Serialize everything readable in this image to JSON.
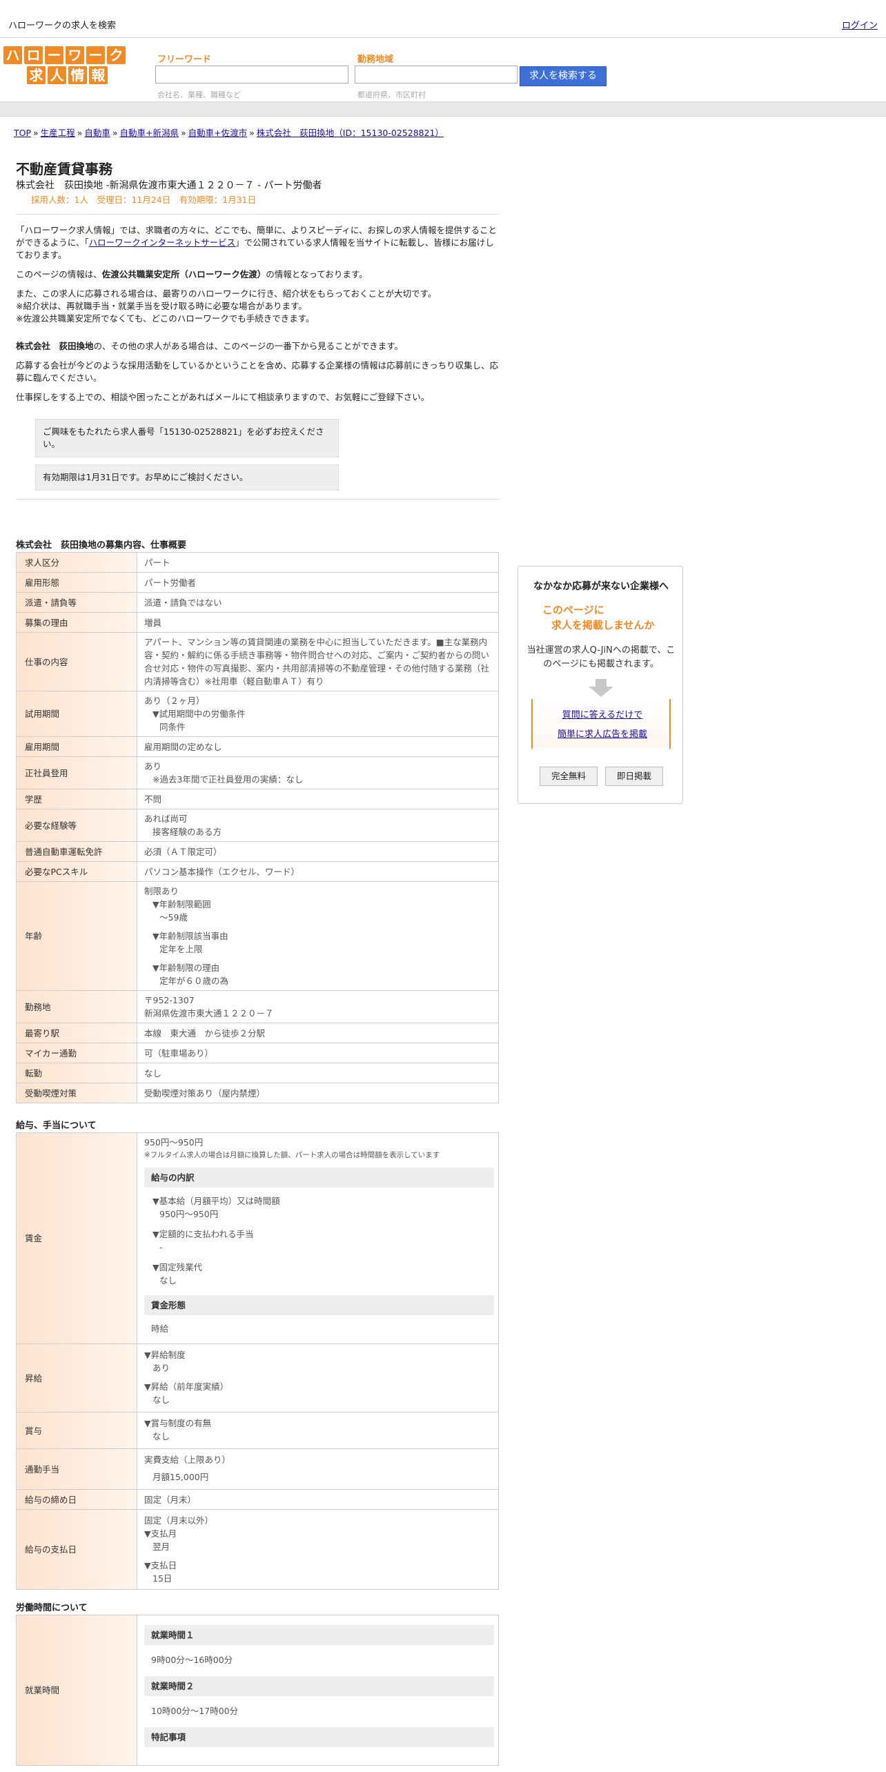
{
  "topbar": {
    "site_title": "ハローワークの求人を検索",
    "login": "ログイン"
  },
  "logo": {
    "row1": [
      "ハ",
      "ロ",
      "ー",
      "ワ",
      "ー",
      "ク"
    ],
    "row2": [
      "求",
      "人",
      "情",
      "報"
    ]
  },
  "search": {
    "freeword_label": "フリーワード",
    "freeword_hint": "会社名、業種、職種など",
    "area_label": "勤務地域",
    "area_hint": "都道府県、市区町村",
    "button": "求人を検索する"
  },
  "breadcrumb": [
    "TOP",
    "生産工程",
    "自動車",
    "自動車+新潟県",
    "自動車+佐渡市",
    "株式会社　荻田換地（ID：15130-02528821）"
  ],
  "job": {
    "title": "不動産賃貸事務",
    "subtitle": "株式会社　荻田換地 -新潟県佐渡市東大通１２２０－７ - パート労働者",
    "meta": "採用人数：1人　受理日：11月24日　有効期限：1月31日"
  },
  "intro": {
    "p1_a": "「ハローワーク求人情報」では、求職者の方々に、どこでも、簡単に、よりスピーディに、お探しの求人情報を提供することができるように、「",
    "p1_link": "ハローワークインターネットサービス",
    "p1_b": "」で公開されている求人情報を当サイトに転載し、皆様にお届けしております。",
    "p2_a": "このページの情報は、",
    "p2_bold": "佐渡公共職業安定所（ハローワーク佐渡）",
    "p2_b": "の情報となっております。",
    "p3_l1": "また、この求人に応募される場合は、最寄りのハローワークに行き、紹介状をもらっておくことが大切です。",
    "p3_l2": "※紹介状は、再就職手当・就業手当を受け取る時に必要な場合があります。",
    "p3_l3": "※佐渡公共職業安定所でなくても、どこのハローワークでも手続きできます。",
    "p4_bold": "株式会社　荻田換地",
    "p4_rest": "の、その他の求人がある場合は、このページの一番下から見ることができます。",
    "p5": "応募する会社が今どのような採用活動をしているかということを含め、応募する企業様の情報は応募前にきっちり収集し、応募に臨んでください。",
    "p6": "仕事探しをする上での、相談や困ったことがあればメールにて相談承りますので、お気軽にご登録下さい。"
  },
  "notices": [
    "ご興味をもたれたら求人番号「15130-02528821」を必ずお控えください。",
    "有効期限は1月31日です。お早めにご検討ください。"
  ],
  "overview": {
    "title": "株式会社　荻田換地の募集内容、仕事概要",
    "rows": [
      {
        "key": "求人区分",
        "lines": [
          "パート"
        ]
      },
      {
        "key": "雇用形態",
        "lines": [
          "パート労働者"
        ]
      },
      {
        "key": "派遣・請負等",
        "lines": [
          "派遣・請負ではない"
        ]
      },
      {
        "key": "募集の理由",
        "lines": [
          "増員"
        ]
      },
      {
        "key": "仕事の内容",
        "lines": [
          "アパート、マンション等の賃貸関連の業務を中心に担当していただきます。■主な業務内容・契約・解約に係る手続き事務等・物件問合せへの対応、ご案内・ご契約者からの問い合せ対応・物件の写真撮影、案内・共用部清掃等の不動産管理・その他付随する業務（社内清掃等含む）※社用車（軽自動車ＡＴ）有り"
        ]
      },
      {
        "key": "試用期間",
        "lines": [
          "あり（２ヶ月）",
          "▼試用期間中の労働条件",
          "同条件"
        ]
      },
      {
        "key": "雇用期間",
        "lines": [
          "雇用期間の定めなし"
        ]
      },
      {
        "key": "正社員登用",
        "lines": [
          "あり",
          "※過去3年間で正社員登用の実績：なし"
        ]
      },
      {
        "key": "学歴",
        "lines": [
          "不問"
        ]
      },
      {
        "key": "必要な経験等",
        "lines": [
          "あれば尚可",
          "接客経験のある方"
        ]
      },
      {
        "key": "普通自動車運転免許",
        "lines": [
          "必須（ＡＴ限定可）"
        ]
      },
      {
        "key": "必要なPCスキル",
        "lines": [
          "パソコン基本操作（エクセル、ワード）"
        ]
      },
      {
        "key": "年齢",
        "lines": [
          "制限あり",
          "▼年齢制限範囲",
          "〜59歳",
          "▼年齢制限該当事由",
          "定年を上限",
          "▼年齢制限の理由",
          "定年が６０歳の為"
        ]
      },
      {
        "key": "勤務地",
        "lines": [
          "〒952-1307",
          "新潟県佐渡市東大通１２２０－７"
        ]
      },
      {
        "key": "最寄り駅",
        "lines": [
          "本線　東大通　から徒歩２分駅"
        ]
      },
      {
        "key": "マイカー通勤",
        "lines": [
          "可（駐車場あり）"
        ]
      },
      {
        "key": "転勤",
        "lines": [
          "なし"
        ]
      },
      {
        "key": "受動喫煙対策",
        "lines": [
          "受動喫煙対策あり（屋内禁煙）"
        ]
      }
    ]
  },
  "salary": {
    "title": "給与、手当について",
    "wage_key": "賃金",
    "wage_range": "950円〜950円",
    "wage_note": "※フルタイム求人の場合は月額に換算した額、パート求人の場合は時間額を表示しています",
    "breakdown_head": "給与の内訳",
    "base_label": "▼基本給（月額平均）又は時間額",
    "base_value": "950円〜950円",
    "fixed_label": "▼定額的に支払われる手当",
    "fixed_value": "-",
    "overtime_label": "▼固定残業代",
    "overtime_value": "なし",
    "form_head": "賃金形態",
    "form_value": "時給",
    "raise_key": "昇給",
    "raise_l1": "▼昇給制度",
    "raise_v1": "あり",
    "raise_l2": "▼昇給（前年度実績）",
    "raise_v2": "なし",
    "bonus_key": "賞与",
    "bonus_l1": "▼賞与制度の有無",
    "bonus_v1": "なし",
    "commute_key": "通勤手当",
    "commute_l1": "実費支給（上限あり）",
    "commute_v1": "月額15,000円",
    "cutoff_key": "給与の締め日",
    "cutoff_value": "固定（月末）",
    "payday_key": "給与の支払日",
    "payday_l1": "固定（月末以外）",
    "payday_l2": "▼支払月",
    "payday_v2": "翌月",
    "payday_l3": "▼支払日",
    "payday_v3": "15日"
  },
  "hours": {
    "title": "労働時間について",
    "key": "就業時間",
    "head1": "就業時間１",
    "val1": "9時00分〜16時00分",
    "head2": "就業時間２",
    "val2": "10時00分〜17時00分",
    "head3": "特記事項"
  },
  "sidebar": {
    "title": "なかなか応募が来ない企業様へ",
    "catch1": "このページに",
    "catch2": "求人を掲載しませんか",
    "desc": "当社運営の求人Q-JiNへの掲載で、このページにも掲載されます。",
    "link1": "質問に答えるだけで",
    "link2": "簡単に求人広告を掲載",
    "btn1": "完全無料",
    "btn2": "即日掲載"
  },
  "colors": {
    "accent": "#f08a24",
    "link": "#1a0dab",
    "button": "#3d6fd8"
  }
}
